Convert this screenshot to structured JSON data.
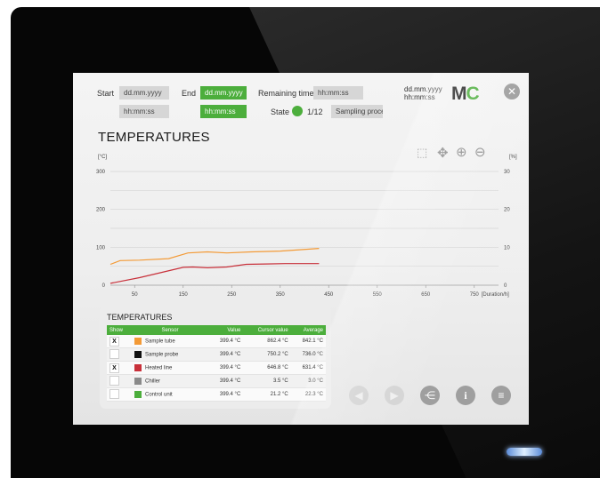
{
  "header": {
    "start_label": "Start",
    "start_date": "dd.mm.yyyy",
    "start_time": "hh:mm:ss",
    "end_label": "End",
    "end_date": "dd.mm.yyyy",
    "end_time": "hh:mm:ss",
    "remaining_label": "Remaining time",
    "remaining_value": "hh:mm:ss",
    "state_label": "State",
    "state_step": "1/12",
    "state_text": "Sampling process r",
    "now_date": "dd.mm.yyyy",
    "now_time": "hh:mm:ss",
    "logo_m": "M",
    "logo_c": "C",
    "close_icon": "close-icon"
  },
  "page_title": "TEMPERATURES",
  "toolbar": {
    "icons": [
      "select-zoom-icon",
      "pan-icon",
      "zoom-in-icon",
      "zoom-out-icon"
    ]
  },
  "chart_data": {
    "type": "line",
    "ylabel_left": "[°C]",
    "ylabel_right": "[%]",
    "xlabel": "[Duration/h]",
    "ylim_left": [
      0,
      300
    ],
    "ylim_right": [
      0,
      30
    ],
    "y_ticks_left": [
      "300",
      "200",
      "100",
      "0"
    ],
    "y_ticks_right": [
      "30",
      "20",
      "10",
      "0"
    ],
    "x_ticks": [
      "50",
      "150",
      "250",
      "350",
      "450",
      "550",
      "650",
      "750"
    ],
    "grid": true,
    "series": [
      {
        "color": "#f39a36",
        "x": [
          0,
          20,
          60,
          120,
          160,
          200,
          240,
          290,
          350,
          430
        ],
        "y": [
          55,
          65,
          66,
          70,
          85,
          88,
          85,
          88,
          90,
          97
        ]
      },
      {
        "color": "#c8303a",
        "x": [
          0,
          60,
          150,
          170,
          200,
          240,
          280,
          320,
          360,
          430
        ],
        "y": [
          5,
          20,
          47,
          48,
          46,
          48,
          55,
          56,
          57,
          57
        ]
      }
    ]
  },
  "legend_panel": {
    "title": "TEMPERATURES",
    "headers": [
      "Show",
      "Sensor",
      "Value",
      "Cursor value",
      "Average"
    ],
    "rows": [
      {
        "show": "X",
        "sensor": "Sample tube",
        "color": "#f39a36",
        "value": "399.4 °C",
        "cursor": "862.4 °C",
        "avg": "842.1 °C"
      },
      {
        "show": "",
        "sensor": "Sample probe",
        "color": "#111111",
        "value": "399.4 °C",
        "cursor": "750.2 °C",
        "avg": "736.0 °C"
      },
      {
        "show": "X",
        "sensor": "Heated line",
        "color": "#c8303a",
        "value": "399.4 °C",
        "cursor": "646.8 °C",
        "avg": "631.4 °C"
      },
      {
        "show": "",
        "sensor": "Chiller",
        "color": "#8a8a8a",
        "value": "399.4 °C",
        "cursor": "3.5 °C",
        "avg": "3.0 °C"
      },
      {
        "show": "",
        "sensor": "Control unit",
        "color": "#4cae3c",
        "value": "399.4 °C",
        "cursor": "21.2 °C",
        "avg": "22.3 °C"
      }
    ]
  },
  "bottom_buttons": [
    "previous-icon",
    "next-icon",
    "network-icon",
    "info-icon",
    "menu-icon"
  ],
  "colors": {
    "accent": "#4cae3c",
    "field": "#d6d6d6",
    "button": "#9a9a9a"
  }
}
